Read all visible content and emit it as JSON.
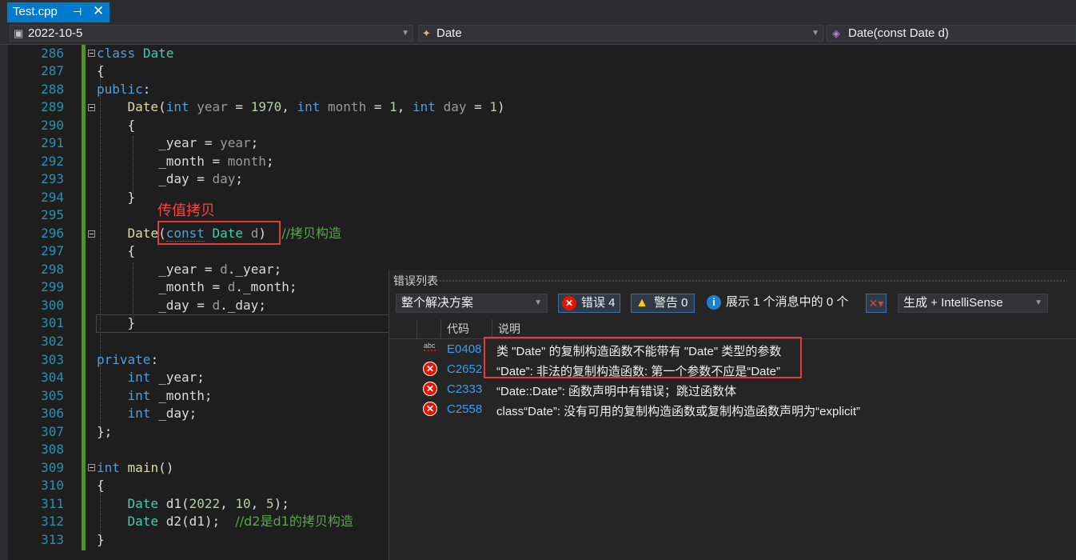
{
  "tab": {
    "title": "Test.cpp",
    "pin": "⊣",
    "close": "✕"
  },
  "nav": {
    "project": "2022-10-5",
    "class": "Date",
    "member": "Date(const Date d)"
  },
  "code": {
    "l286": "286",
    "l287": "287",
    "l288": "288",
    "l289": "289",
    "l290": "290",
    "l291": "291",
    "l292": "292",
    "l293": "293",
    "l294": "294",
    "l295": "295",
    "l296": "296",
    "l297": "297",
    "l298": "298",
    "l299": "299",
    "l300": "300",
    "l301": "301",
    "l302": "302",
    "l303": "303",
    "l304": "304",
    "l305": "305",
    "l306": "306",
    "l307": "307",
    "l308": "308",
    "l309": "309",
    "l310": "310",
    "l311": "311",
    "l312": "312",
    "l313": "313",
    "comment_copy_ctor": "//拷贝构造",
    "comment_d2": "//d2是d1的拷贝构造"
  },
  "annotation": {
    "text": "传值拷贝"
  },
  "error_list": {
    "title": "错误列表",
    "scope": "整个解决方案",
    "errors_btn": "错误 4",
    "warnings_btn": "警告 0",
    "messages": "展示 1 个消息中的 0 个",
    "source": "生成 + IntelliSense",
    "col_code": "代码",
    "col_desc": "说明",
    "rows": [
      {
        "code": "E0408",
        "desc": "类 \"Date\" 的复制构造函数不能带有 \"Date\" 类型的参数",
        "icon": "abc"
      },
      {
        "code": "C2652",
        "desc": "“Date”: 非法的复制构造函数: 第一个参数不应是“Date”",
        "icon": "error"
      },
      {
        "code": "C2333",
        "desc": "“Date::Date”: 函数声明中有错误；跳过函数体",
        "icon": "error"
      },
      {
        "code": "C2558",
        "desc": "class“Date”: 没有可用的复制构造函数或复制构造函数声明为“explicit”",
        "icon": "error"
      }
    ]
  },
  "colors": {
    "accent": "#007acc",
    "error": "#e51400",
    "comment": "#57a64a",
    "keyword": "#569cd6"
  }
}
